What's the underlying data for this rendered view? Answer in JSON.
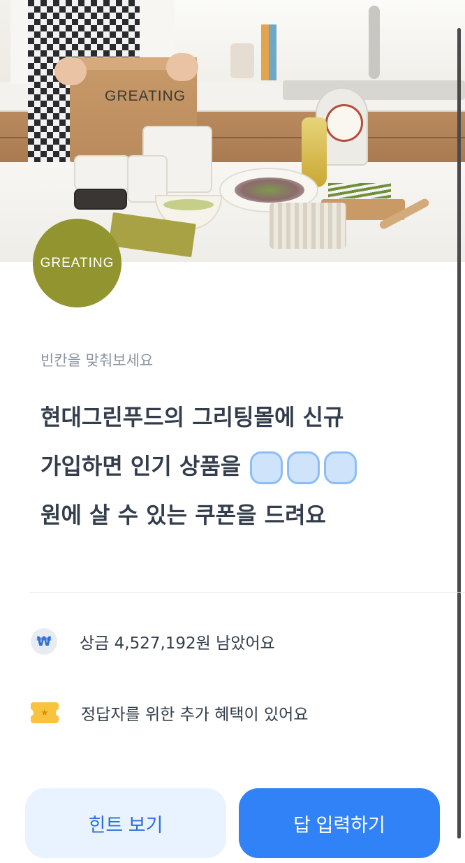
{
  "hero": {
    "box_brand": "GREATING",
    "logo_text": "GREATING"
  },
  "quiz": {
    "subtitle": "빈칸을 맞춰보세요",
    "question_line1": "현대그린푸드의 그리팅몰에 신규",
    "question_line2": "가입하면 인기 상품을",
    "question_line3": "원에 살 수 있는 쿠폰을 드려요",
    "blank_count": 3
  },
  "info": {
    "prize_icon": "won-icon",
    "prize_icon_glyph": "₩",
    "prize_text": "상금 4,527,192원 남았어요",
    "benefit_icon": "ticket-icon",
    "benefit_text": "정답자를 위한 추가 혜택이 있어요"
  },
  "buttons": {
    "hint_label": "힌트 보기",
    "answer_label": "답 입력하기"
  },
  "colors": {
    "primary": "#3182f6",
    "primary_light": "#e8f3ff",
    "brand_olive": "#929430",
    "blank_fill": "#cfe3fb"
  }
}
